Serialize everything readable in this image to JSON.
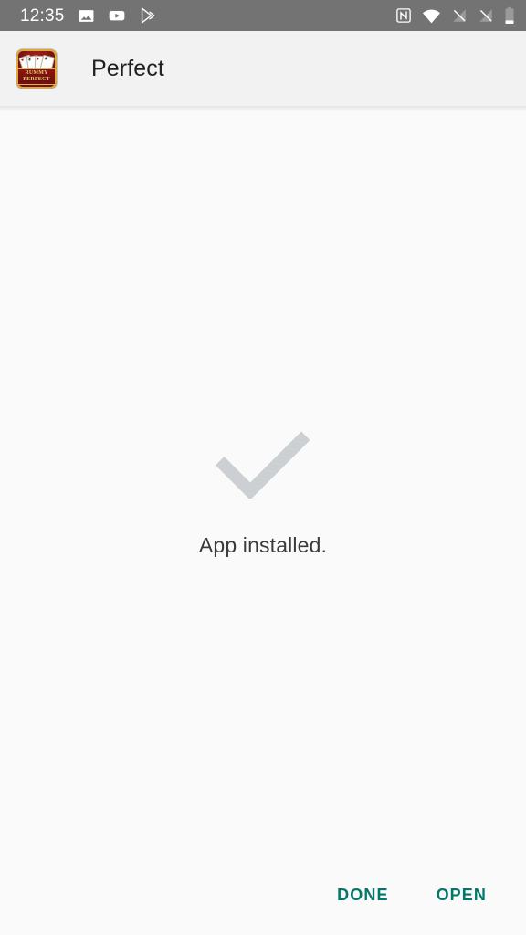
{
  "status_bar": {
    "clock": "12:35",
    "background_color": "#737373",
    "left_icons": [
      {
        "name": "photos-icon",
        "label": "Photos"
      },
      {
        "name": "youtube-icon",
        "label": "YouTube"
      },
      {
        "name": "play-store-icon",
        "label": "Google Play Store"
      }
    ],
    "right_icons": [
      {
        "name": "nfc-icon",
        "label": "NFC"
      },
      {
        "name": "wifi-icon",
        "label": "Wi-Fi"
      },
      {
        "name": "no-sim-1-icon",
        "label": "No SIM 1"
      },
      {
        "name": "no-sim-2-icon",
        "label": "No SIM 2"
      },
      {
        "name": "battery-icon",
        "label": "Battery"
      }
    ]
  },
  "app_bar": {
    "title": "Perfect",
    "icon": {
      "name": "app-icon",
      "banner_line1": "RUMMY",
      "banner_line2": "PERFECT",
      "background_color": "#7d1410",
      "border_color": "#e0a93c",
      "text_color": "#f4cf72"
    },
    "background_color": "#f2f2f2",
    "title_color": "#212121"
  },
  "content": {
    "status_icon": "check-icon",
    "status_icon_color": "#ccd0d2",
    "message": "App installed.",
    "message_color": "#3b3b3b",
    "background_color": "#fafafa"
  },
  "actions": {
    "accent_color": "#00796b",
    "buttons": [
      {
        "name": "done-button",
        "label": "DONE"
      },
      {
        "name": "open-button",
        "label": "OPEN"
      }
    ]
  }
}
